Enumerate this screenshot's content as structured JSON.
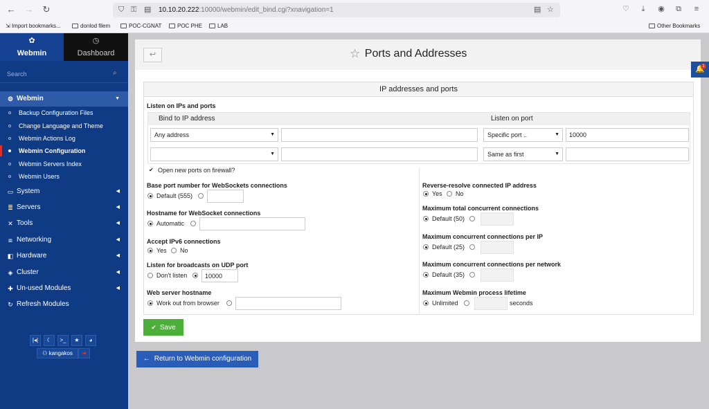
{
  "browser": {
    "url_host": "10.10.20.222",
    "url_rest": ":10000/webmin/edit_bind.cgi?xnavigation=1",
    "bookmarks": [
      "Import bookmarks...",
      "donlod filem",
      "POC-CGNAT",
      "POC PHE",
      "LAB"
    ],
    "other_bookmarks": "Other Bookmarks"
  },
  "sidebar": {
    "tab_webmin": "Webmin",
    "tab_dashboard": "Dashboard",
    "search_placeholder": "Search",
    "active_section": "Webmin",
    "sub_items": [
      "Backup Configuration Files",
      "Change Language and Theme",
      "Webmin Actions Log",
      "Webmin Configuration",
      "Webmin Servers Index",
      "Webmin Users"
    ],
    "sections": [
      "System",
      "Servers",
      "Tools",
      "Networking",
      "Hardware",
      "Cluster",
      "Un-used Modules",
      "Refresh Modules"
    ],
    "username": "kangakos"
  },
  "page": {
    "title": "Ports and Addresses",
    "section_header": "IP addresses and ports",
    "listen_label": "Listen on IPs and ports",
    "col_bind": "Bind to IP address",
    "col_port": "Listen on port",
    "row1": {
      "bind_select": "Any address",
      "bind_value": "",
      "port_select": "Specific port ..",
      "port_value": "10000"
    },
    "row2": {
      "bind_select": "",
      "bind_value": "",
      "port_select": "Same as first",
      "port_value": ""
    },
    "firewall_label": "Open new ports on firewall?",
    "left": {
      "ws_base_label": "Base port number for WebSockets connections",
      "ws_base_default": "Default (555)",
      "ws_host_label": "Hostname for WebSocket connections",
      "ws_host_auto": "Automatic",
      "ipv6_label": "Accept IPv6 connections",
      "ipv6_yes": "Yes",
      "ipv6_no": "No",
      "udp_label": "Listen for broadcasts on UDP port",
      "udp_dont": "Don't listen",
      "udp_value": "10000",
      "webhost_label": "Web server hostname",
      "webhost_auto": "Work out from browser"
    },
    "right": {
      "resolve_label": "Reverse-resolve connected IP address",
      "resolve_yes": "Yes",
      "resolve_no": "No",
      "max_total_label": "Maximum total concurrent connections",
      "max_total_default": "Default (50)",
      "max_ip_label": "Maximum concurrent connections per IP",
      "max_ip_default": "Default (25)",
      "max_net_label": "Maximum concurrent connections per network",
      "max_net_default": "Default (35)",
      "lifetime_label": "Maximum Webmin process lifetime",
      "lifetime_unlimited": "Unlimited",
      "lifetime_unit": "seconds"
    },
    "save_label": "Save",
    "return_label": "Return to Webmin configuration"
  },
  "notification_count": "1",
  "colors": {
    "sidebar": "#0f3b84",
    "save": "#4caf3a",
    "return": "#2a5db8"
  }
}
